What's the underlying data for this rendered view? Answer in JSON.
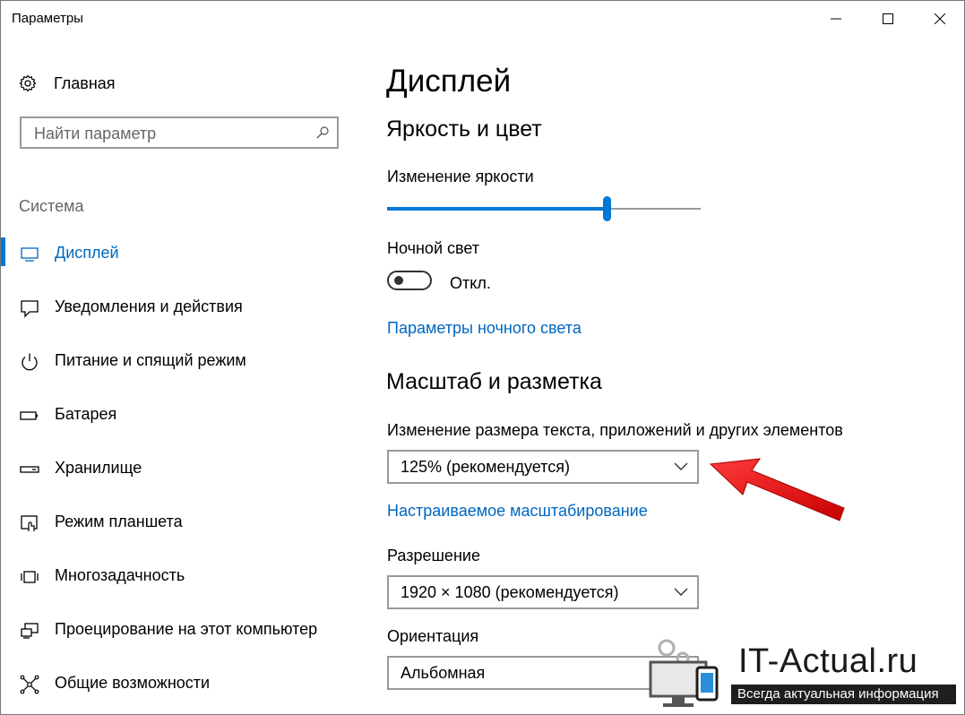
{
  "window": {
    "title": "Параметры"
  },
  "sidebar": {
    "home_label": "Главная",
    "search_placeholder": "Найти параметр",
    "section_label": "Система",
    "items": [
      {
        "label": "Дисплей",
        "icon": "monitor-icon",
        "active": true
      },
      {
        "label": "Уведомления и действия",
        "icon": "notification-icon",
        "active": false
      },
      {
        "label": "Питание и спящий режим",
        "icon": "power-icon",
        "active": false
      },
      {
        "label": "Батарея",
        "icon": "battery-icon",
        "active": false
      },
      {
        "label": "Хранилище",
        "icon": "storage-icon",
        "active": false
      },
      {
        "label": "Режим планшета",
        "icon": "tablet-mode-icon",
        "active": false
      },
      {
        "label": "Многозадачность",
        "icon": "multitasking-icon",
        "active": false
      },
      {
        "label": "Проецирование на этот компьютер",
        "icon": "projecting-icon",
        "active": false
      },
      {
        "label": "Общие возможности",
        "icon": "shared-experiences-icon",
        "active": false
      }
    ]
  },
  "main": {
    "title": "Дисплей",
    "brightness_section": "Яркость и цвет",
    "brightness_label": "Изменение яркости",
    "brightness_level": 0.7,
    "night_light_label": "Ночной свет",
    "night_light_state": "Откл.",
    "night_light_settings_link": "Параметры ночного света",
    "scale_section": "Масштаб и разметка",
    "scale_label": "Изменение размера текста, приложений и других элементов",
    "scale_value": "125% (рекомендуется)",
    "custom_scaling_link": "Настраиваемое масштабирование",
    "resolution_label": "Разрешение",
    "resolution_value": "1920 × 1080 (рекомендуется)",
    "orientation_label": "Ориентация",
    "orientation_value": "Альбомная"
  },
  "watermark": {
    "site": "IT-Actual.ru",
    "tagline": "Всегда актуальная информация"
  },
  "colors": {
    "accent": "#0078d7",
    "link": "#0067c0",
    "annotation_arrow": "#e01010"
  }
}
